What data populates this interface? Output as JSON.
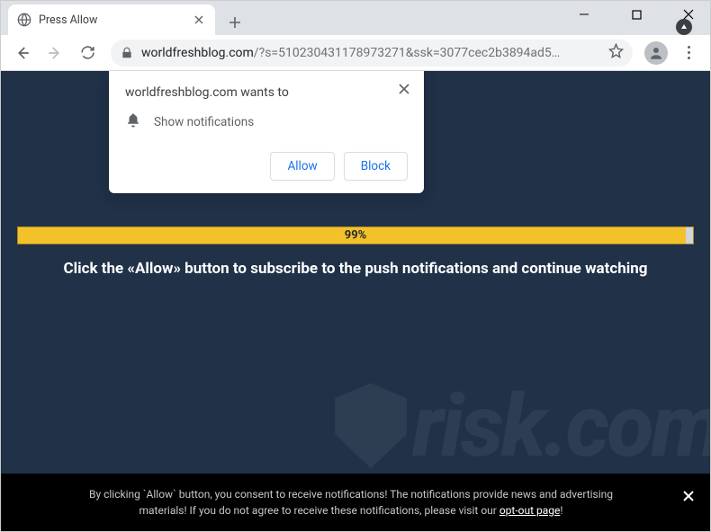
{
  "tab": {
    "title": "Press Allow"
  },
  "omnibox": {
    "host": "worldfreshblog.com",
    "path": "/?s=510230431178973271&ssk=3077cec2b3894ad5…"
  },
  "popup": {
    "title": "worldfreshblog.com wants to",
    "permission": "Show notifications",
    "allow": "Allow",
    "block": "Block"
  },
  "progress": {
    "percent": "99%"
  },
  "main_text_pre": "Click the ",
  "main_text_bold": "«Allow»",
  "main_text_post": " button to subscribe to the push notifications and continue watching",
  "consent": {
    "line1": "By clicking `Allow` button, you consent to receive notifications! The notifications provide news and advertising",
    "line2a": "materials! If you do not agree to receive these notifications, please visit our ",
    "link": "opt-out page",
    "line2b": "!"
  },
  "watermark": "risk.com"
}
